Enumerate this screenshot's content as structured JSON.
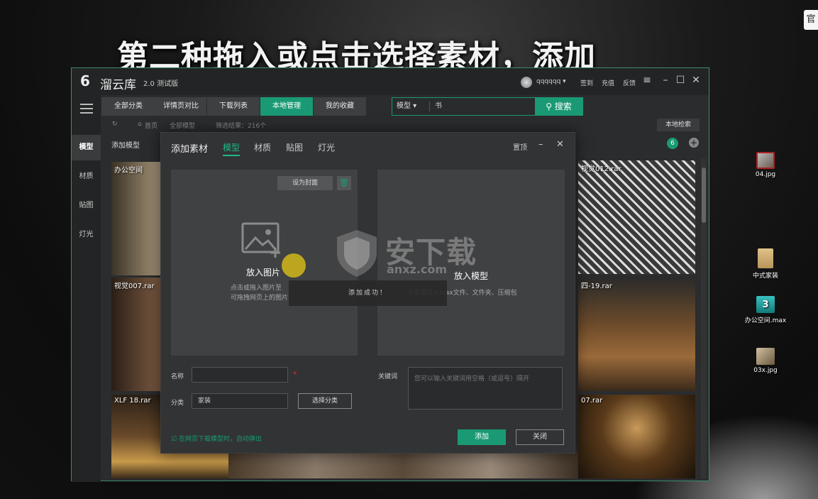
{
  "caption": "第二种拖入或点击选择素材，添加",
  "corner_chip": "官",
  "desktop_icons": [
    {
      "label": "04.jpg"
    },
    {
      "label": "中式家装"
    },
    {
      "label": "办公空间.max"
    },
    {
      "label": "03x.jpg"
    }
  ],
  "app": {
    "logo_glyph": "6",
    "name": "溜云库",
    "version": "2.0 测试版",
    "username": "qqqqqq",
    "topbar": [
      "签到",
      "充值",
      "反馈"
    ],
    "leftbar": [
      "模型",
      "材质",
      "贴图",
      "灯光"
    ],
    "tabs": [
      "全部分类",
      "详情页对比",
      "下载列表",
      "本地管理",
      "我的收藏"
    ],
    "active_tab": "本地管理",
    "search": {
      "category": "模型",
      "query": "书",
      "button": "搜索"
    },
    "breadcrumb": {
      "home": "首页",
      "level": "全部模型",
      "result": "筛选结果：216个"
    },
    "local_search": "本地检索",
    "sub_title": "添加模型",
    "circle_badge": "6",
    "thumbnails": [
      {
        "label": "办公空间"
      },
      {
        "label": "视觉007.rar"
      },
      {
        "label": "XLF 18.rar"
      },
      {
        "label": "视觉012.rar"
      },
      {
        "label": "四-19.rar"
      },
      {
        "label": "07.rar"
      }
    ]
  },
  "modal": {
    "title": "添加素材",
    "tabs": [
      "模型",
      "材质",
      "贴图",
      "灯光"
    ],
    "active_tab": "模型",
    "pin": "置顶",
    "set_cover": "设为封面",
    "drop_image_label": "放入图片",
    "drop_image_hint_1": "点击或拖入图片至",
    "drop_image_hint_2": "可拖拽网页上的图片",
    "toast": "添加成功！",
    "drop_model_label": "放入模型",
    "drop_model_hint": "点击或拖入max文件、文件夹、压缩包",
    "name_label": "名称",
    "name_value": "",
    "required_mark": "*",
    "category_label": "分类",
    "category_value": "家装",
    "choose_category": "选择分类",
    "keyword_label": "关键词",
    "keyword_placeholder": "您可以输入关键词用空格（或逗号）隔开",
    "auto_popup": "在网页下载模型时，自动弹出",
    "add_button": "添加",
    "close_button": "关闭"
  },
  "watermark": {
    "text": "安下载",
    "sub": "anxz.com"
  },
  "colors": {
    "accent": "#1a9a74",
    "bg": "#2b2c2e"
  }
}
